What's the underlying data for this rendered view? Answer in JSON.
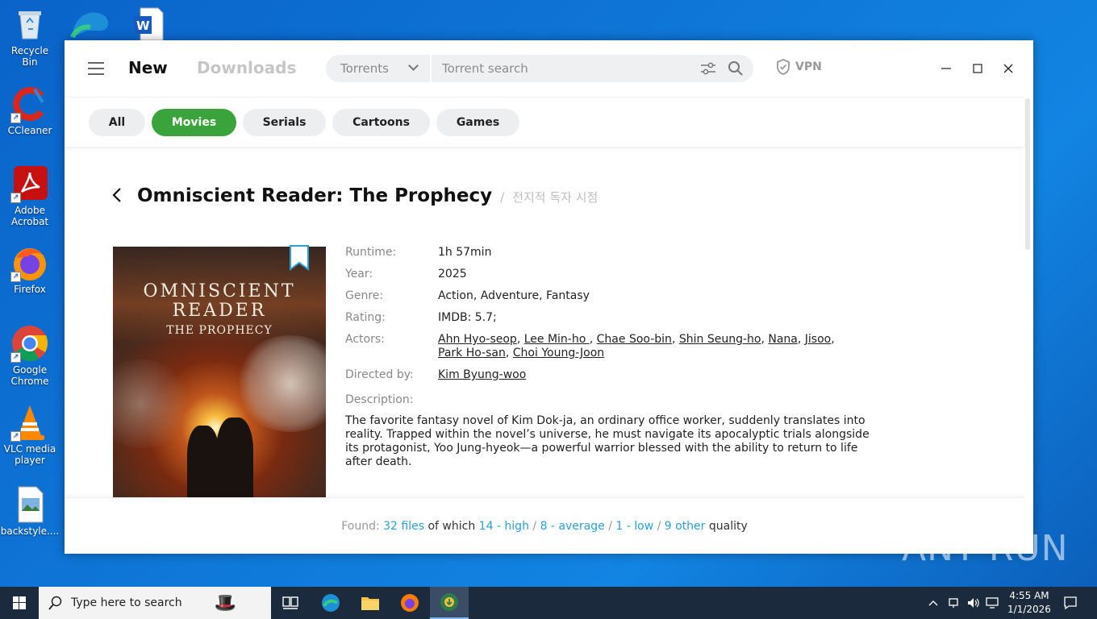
{
  "desktop": {
    "icons": [
      {
        "label": "Recycle Bin"
      },
      {
        "label": "CCleaner"
      },
      {
        "label": "Adobe Acrobat"
      },
      {
        "label": "Firefox"
      },
      {
        "label": "Google Chrome"
      },
      {
        "label": "VLC media player"
      },
      {
        "label": "backstyle...."
      }
    ]
  },
  "app": {
    "tabs": {
      "new": "New",
      "downloads": "Downloads"
    },
    "search": {
      "source": "Torrents",
      "placeholder": "Torrent search"
    },
    "vpn_label": "VPN",
    "categories": [
      "All",
      "Movies",
      "Serials",
      "Cartoons",
      "Games"
    ],
    "active_category": "Movies",
    "movie": {
      "title": "Omniscient Reader: The Prophecy",
      "separator": "/",
      "original_title": "전지적 독자 시점",
      "poster": {
        "title_line1": "OMNISCIENT",
        "title_line2": "READER",
        "title_line3": "THE PROPHECY"
      },
      "labels": {
        "runtime": "Runtime:",
        "year": "Year:",
        "genre": "Genre:",
        "rating": "Rating:",
        "actors": "Actors:",
        "directed_by": "Directed by:",
        "description": "Description:"
      },
      "runtime": "1h 57min",
      "year": "2025",
      "genre": "Action, Adventure, Fantasy",
      "rating": "IMDB: 5.7;",
      "actors": [
        "Ahn Hyo-seop",
        "Lee Min-ho ",
        "Chae Soo-bin",
        "Shin Seung-ho",
        "Nana",
        "Jisoo",
        "Park Ho-san",
        "Choi Young-Joon"
      ],
      "director": "Kim Byung-woo",
      "description": "The favorite fantasy novel of Kim Dok-ja, an ordinary office worker, suddenly translates into reality. Trapped within the novel’s universe, he must navigate its apocalyptic trials alongside its protagonist, Yoo Jung-hyeok—a powerful warrior blessed with the ability to return to life after death."
    },
    "footer": {
      "found_label": "Found:",
      "files": "32 files",
      "of_which": "of which",
      "high": "14 - high",
      "average": "8 - average",
      "low": "1 - low",
      "other": "9 other",
      "quality": "quality",
      "slash": "/"
    }
  },
  "watermark": "ANY RUN",
  "taskbar": {
    "search_placeholder": "Type here to search",
    "time": "4:55 AM",
    "date": "1/1/2026"
  },
  "colors": {
    "accent_green": "#3aa33c",
    "link_blue": "#2a9fd6",
    "desktop_blue": "#0f78d8"
  }
}
